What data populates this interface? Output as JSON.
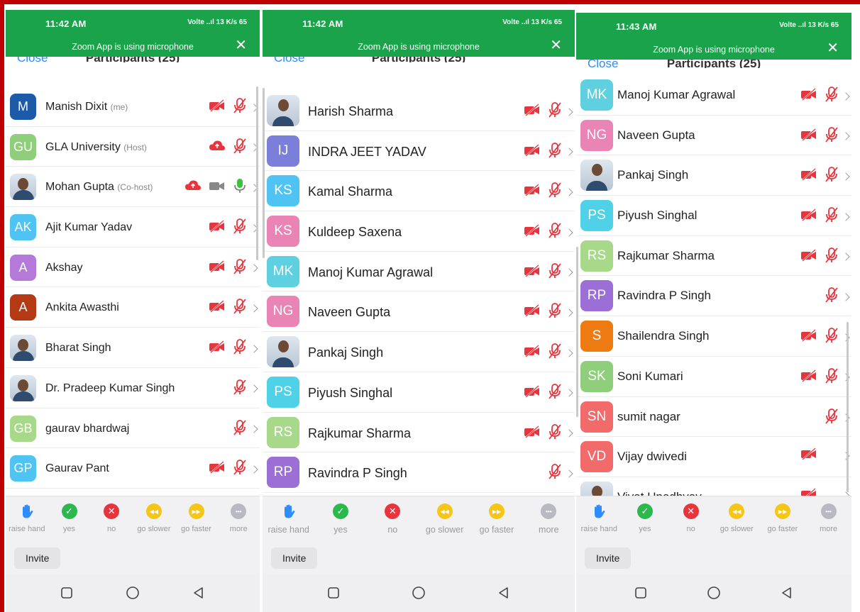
{
  "colors": {
    "statusbar_green": "#1aa34a",
    "link_blue": "#2d8cff",
    "muted_red": "#e8343c",
    "border_red": "#c00000"
  },
  "status_bar": {
    "times": [
      "11:42 AM",
      "11:42 AM",
      "11:43 AM"
    ],
    "indicators": "Volte ..ıl  13 K/s  65",
    "mic_message": "Zoom App is using microphone",
    "close_glyph": "✕"
  },
  "header": {
    "close_label": "Close",
    "title": "Participants (25)"
  },
  "panels": [
    {
      "participants": [
        {
          "name": "Manish Dixit",
          "role": "(me)",
          "initials": "M",
          "color": "#1d5ba8",
          "photo": false,
          "video_muted": true,
          "mic_muted": true
        },
        {
          "name": "GLA University",
          "role": "(Host)",
          "initials": "GU",
          "color": "#8fcf7c",
          "photo": false,
          "cloud": true,
          "video_muted": false,
          "mic_muted": true
        },
        {
          "name": "Mohan Gupta",
          "role": "(Co-host)",
          "initials": "",
          "color": "#8a7f5c",
          "photo": true,
          "cloud": true,
          "video_gray": true,
          "mic_active": true
        },
        {
          "name": "Ajit Kumar Yadav",
          "role": "",
          "initials": "AK",
          "color": "#4fc3f2",
          "photo": false,
          "video_muted": true,
          "mic_muted": true
        },
        {
          "name": "Akshay",
          "role": "",
          "initials": "A",
          "color": "#b479d9",
          "photo": false,
          "video_muted": true,
          "mic_muted": true
        },
        {
          "name": "Ankita Awasthi",
          "role": "",
          "initials": "A",
          "color": "#b33a14",
          "photo": false,
          "video_muted": true,
          "mic_muted": true
        },
        {
          "name": "Bharat Singh",
          "role": "",
          "initials": "",
          "color": "#cccccc",
          "photo": true,
          "video_muted": true,
          "mic_muted": true
        },
        {
          "name": "Dr. Pradeep Kumar Singh",
          "role": "",
          "initials": "",
          "color": "#cccccc",
          "photo": true,
          "video_muted": false,
          "mic_muted": true
        },
        {
          "name": "gaurav bhardwaj",
          "role": "",
          "initials": "GB",
          "color": "#a8d98a",
          "photo": false,
          "video_muted": false,
          "mic_muted": true
        },
        {
          "name": "Gaurav Pant",
          "role": "",
          "initials": "GP",
          "color": "#4fc3f2",
          "photo": false,
          "video_muted": true,
          "mic_muted": true
        }
      ]
    },
    {
      "participants": [
        {
          "name": "Harish Sharma",
          "role": "",
          "initials": "",
          "color": "#cccccc",
          "photo": true,
          "video_muted": true,
          "mic_muted": true
        },
        {
          "name": "INDRA JEET YADAV",
          "role": "",
          "initials": "IJ",
          "color": "#7c7fd9",
          "photo": false,
          "video_muted": true,
          "mic_muted": true
        },
        {
          "name": "Kamal Sharma",
          "role": "",
          "initials": "KS",
          "color": "#4fc3f2",
          "photo": false,
          "video_muted": true,
          "mic_muted": true
        },
        {
          "name": "Kuldeep Saxena",
          "role": "",
          "initials": "KS",
          "color": "#ea84b5",
          "photo": false,
          "video_muted": true,
          "mic_muted": true
        },
        {
          "name": "Manoj Kumar Agrawal",
          "role": "",
          "initials": "MK",
          "color": "#5fd0e0",
          "photo": false,
          "video_muted": true,
          "mic_muted": true
        },
        {
          "name": "Naveen Gupta",
          "role": "",
          "initials": "NG",
          "color": "#ea84b5",
          "photo": false,
          "video_muted": true,
          "mic_muted": true
        },
        {
          "name": "Pankaj Singh",
          "role": "",
          "initials": "",
          "color": "#cccccc",
          "photo": true,
          "video_muted": true,
          "mic_muted": true
        },
        {
          "name": "Piyush Singhal",
          "role": "",
          "initials": "PS",
          "color": "#4fd1e8",
          "photo": false,
          "video_muted": true,
          "mic_muted": true
        },
        {
          "name": "Rajkumar Sharma",
          "role": "",
          "initials": "RS",
          "color": "#a8d98a",
          "photo": false,
          "video_muted": true,
          "mic_muted": true
        },
        {
          "name": "Ravindra P Singh",
          "role": "",
          "initials": "RP",
          "color": "#9b6fd6",
          "photo": false,
          "video_muted": false,
          "mic_muted": true
        }
      ]
    },
    {
      "participants": [
        {
          "name": "Manoj Kumar Agrawal",
          "role": "",
          "initials": "MK",
          "color": "#5fd0e0",
          "photo": false,
          "video_muted": true,
          "mic_muted": true
        },
        {
          "name": "Naveen Gupta",
          "role": "",
          "initials": "NG",
          "color": "#ea84b5",
          "photo": false,
          "video_muted": true,
          "mic_muted": true
        },
        {
          "name": "Pankaj Singh",
          "role": "",
          "initials": "",
          "color": "#cccccc",
          "photo": true,
          "video_muted": true,
          "mic_muted": true
        },
        {
          "name": "Piyush Singhal",
          "role": "",
          "initials": "PS",
          "color": "#4fd1e8",
          "photo": false,
          "video_muted": true,
          "mic_muted": true
        },
        {
          "name": "Rajkumar Sharma",
          "role": "",
          "initials": "RS",
          "color": "#a8d98a",
          "photo": false,
          "video_muted": true,
          "mic_muted": true
        },
        {
          "name": "Ravindra P Singh",
          "role": "",
          "initials": "RP",
          "color": "#9b6fd6",
          "photo": false,
          "video_muted": false,
          "mic_muted": true
        },
        {
          "name": "Shailendra Singh",
          "role": "",
          "initials": "S",
          "color": "#ee7a12",
          "photo": false,
          "video_muted": true,
          "mic_muted": true
        },
        {
          "name": "Soni Kumari",
          "role": "",
          "initials": "SK",
          "color": "#8fcf7c",
          "photo": false,
          "video_muted": true,
          "mic_muted": true
        },
        {
          "name": "sumit nagar",
          "role": "",
          "initials": "SN",
          "color": "#f26a6a",
          "photo": false,
          "video_muted": false,
          "mic_muted": true
        },
        {
          "name": "Vijay dwivedi",
          "role": "",
          "initials": "VD",
          "color": "#f26a6a",
          "photo": false,
          "video_muted": true,
          "mic_muted": false
        },
        {
          "name": "Vivat Upadhyay",
          "role": "",
          "initials": "",
          "color": "#cccccc",
          "photo": true,
          "video_muted": true,
          "mic_muted": false
        }
      ]
    }
  ],
  "reactions": [
    {
      "label": "raise hand",
      "icon": "raise-hand-icon",
      "color": "#2d8cff"
    },
    {
      "label": "yes",
      "icon": "check-icon",
      "color": "#2db84d"
    },
    {
      "label": "no",
      "icon": "x-icon",
      "color": "#e8343c"
    },
    {
      "label": "go slower",
      "icon": "rewind-icon",
      "color": "#f5c518"
    },
    {
      "label": "go faster",
      "icon": "fast-forward-icon",
      "color": "#f5c518"
    },
    {
      "label": "more",
      "icon": "more-icon",
      "color": "#b9b9c2"
    }
  ],
  "invite_label": "Invite",
  "navbar": [
    "square-nav-icon",
    "circle-nav-icon",
    "back-nav-icon"
  ]
}
